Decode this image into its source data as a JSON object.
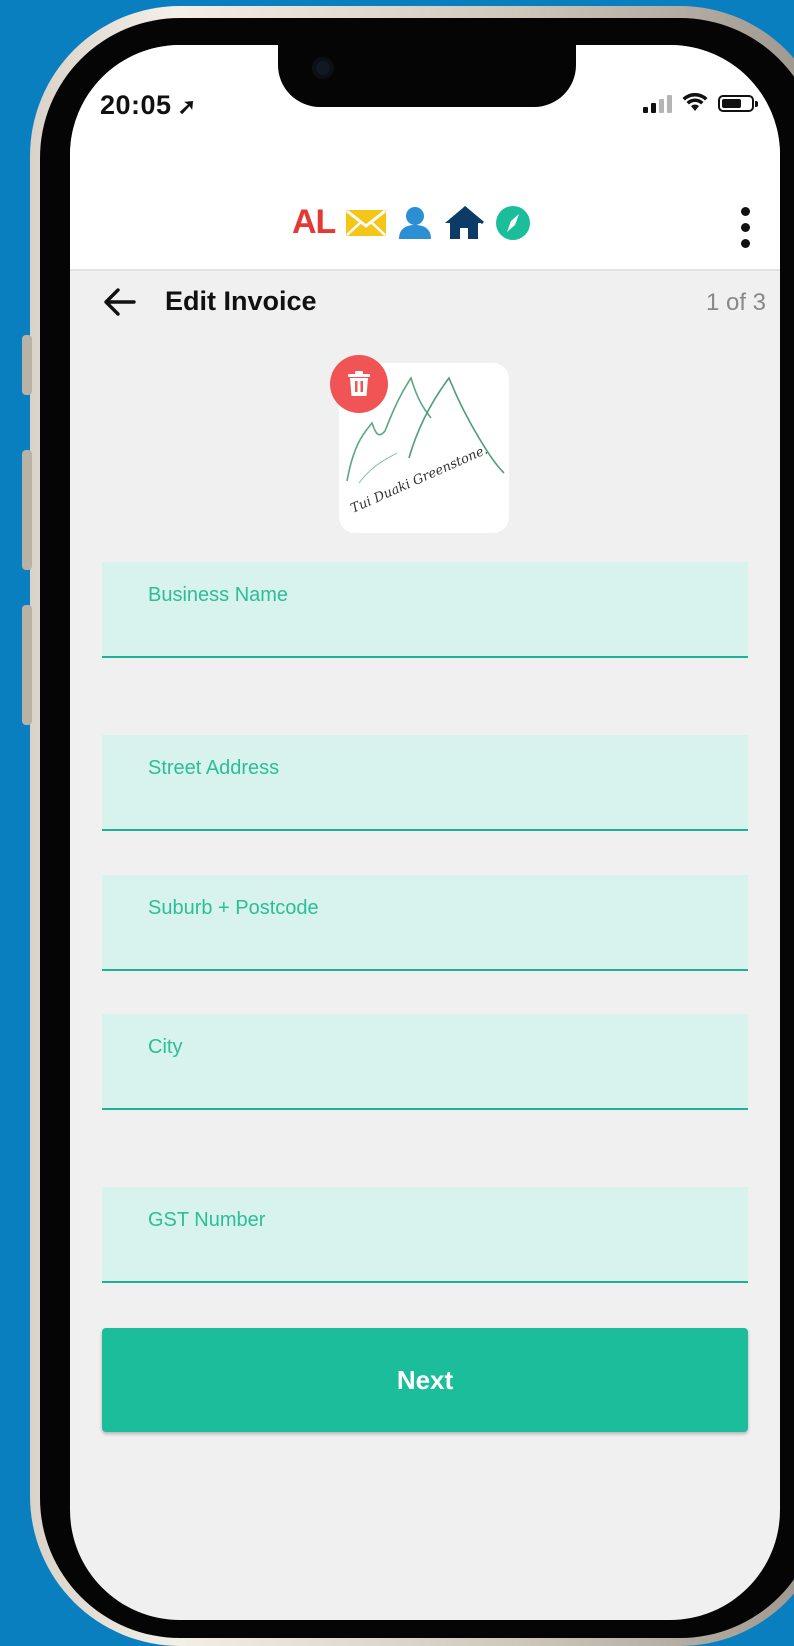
{
  "status_bar": {
    "time": "20:05"
  },
  "app_bar": {
    "brand_text": "AL",
    "brand_icons": [
      "envelope-icon",
      "person-icon",
      "house-icon",
      "compass-icon"
    ],
    "brand_colors": {
      "al": "#e53935",
      "envelope": "#f5c518",
      "person": "#2b8fd4",
      "house": "#0b3b66",
      "compass": "#1bbd9b"
    }
  },
  "header": {
    "title": "Edit Invoice",
    "page_indicator": "1 of 3"
  },
  "logo": {
    "signature_text": "Tui Duaki Greenstone."
  },
  "form": {
    "fields": [
      {
        "label": "Business Name",
        "value": ""
      },
      {
        "label": "Street Address",
        "value": ""
      },
      {
        "label": "Suburb + Postcode",
        "value": ""
      },
      {
        "label": "City",
        "value": ""
      },
      {
        "label": "GST Number",
        "value": ""
      }
    ],
    "submit_label": "Next"
  },
  "colors": {
    "accent": "#1bbd9b",
    "field_bg": "#d8f2ed",
    "delete": "#f05454",
    "background": "#0a7fbf"
  }
}
